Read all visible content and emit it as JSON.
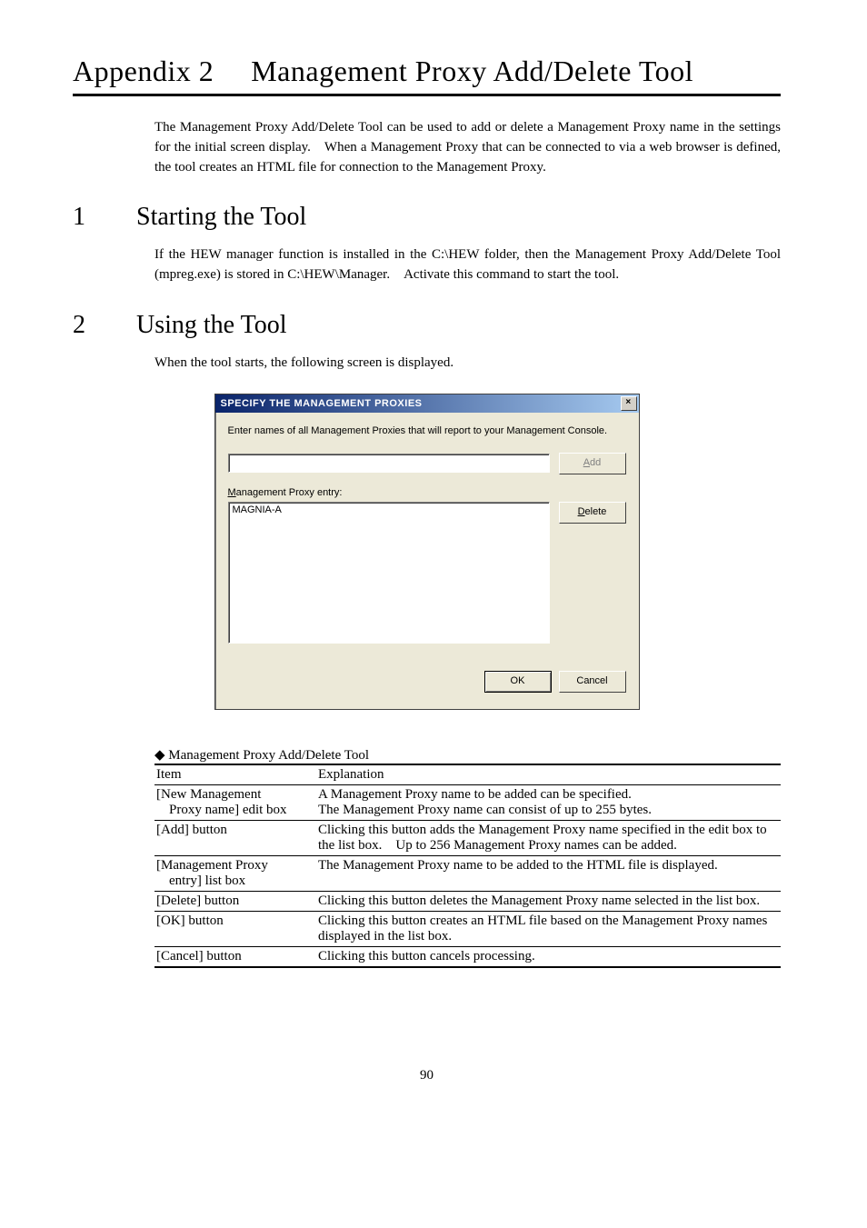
{
  "title": "Appendix 2  Management Proxy Add/Delete Tool",
  "intro": "The Management Proxy Add/Delete Tool can be used to add or delete a Management Proxy name in the settings for the initial screen display. When a Management Proxy that can be connected to via a web browser is defined, the tool creates an HTML file for connection to the Management Proxy.",
  "sections": {
    "s1": {
      "num": "1",
      "title": "Starting the Tool",
      "body": "If the HEW manager function is installed in the C:\\HEW folder, then the Management Proxy Add/Delete Tool (mpreg.exe) is stored in C:\\HEW\\Manager. Activate this command to start the tool."
    },
    "s2": {
      "num": "2",
      "title": "Using the Tool",
      "body": "When the tool starts, the following screen is displayed."
    }
  },
  "dialog": {
    "title": "SPECIFY THE MANAGEMENT PROXIES",
    "instruction": "Enter names of all Management Proxies that will report to your Management Console.",
    "addLabelPrefix": "A",
    "addLabelRest": "dd",
    "listLabelPrefix": "M",
    "listLabelRest": "anagement Proxy entry:",
    "listItem": "MAGNIA-A",
    "deleteLabelPrefix": "D",
    "deleteLabelRest": "elete",
    "ok": "OK",
    "cancel": "Cancel",
    "close": "×"
  },
  "tableCaption": "◆ Management Proxy Add/Delete Tool",
  "table": {
    "head": {
      "c1": "Item",
      "c2": "Explanation"
    },
    "rows": [
      {
        "item": "[New Management",
        "itemSub": "Proxy name] edit box",
        "exp": "A Management Proxy name to be added can be specified.\nThe Management Proxy name can consist of up to 255 bytes."
      },
      {
        "item": "[Add] button",
        "exp": "Clicking this button adds the Management Proxy name specified in the edit box to the list box. Up to 256 Management Proxy names can be added."
      },
      {
        "item": "[Management Proxy",
        "itemSub": "entry] list box",
        "exp": "The Management Proxy name to be added to the HTML file is displayed."
      },
      {
        "item": "[Delete] button",
        "exp": "Clicking this button deletes the Management Proxy name selected in the list box."
      },
      {
        "item": "[OK] button",
        "exp": "Clicking this button creates an HTML file based on the Management Proxy names displayed in the list box."
      },
      {
        "item": "[Cancel] button",
        "exp": "Clicking this button cancels processing."
      }
    ]
  },
  "pageNumber": "90"
}
